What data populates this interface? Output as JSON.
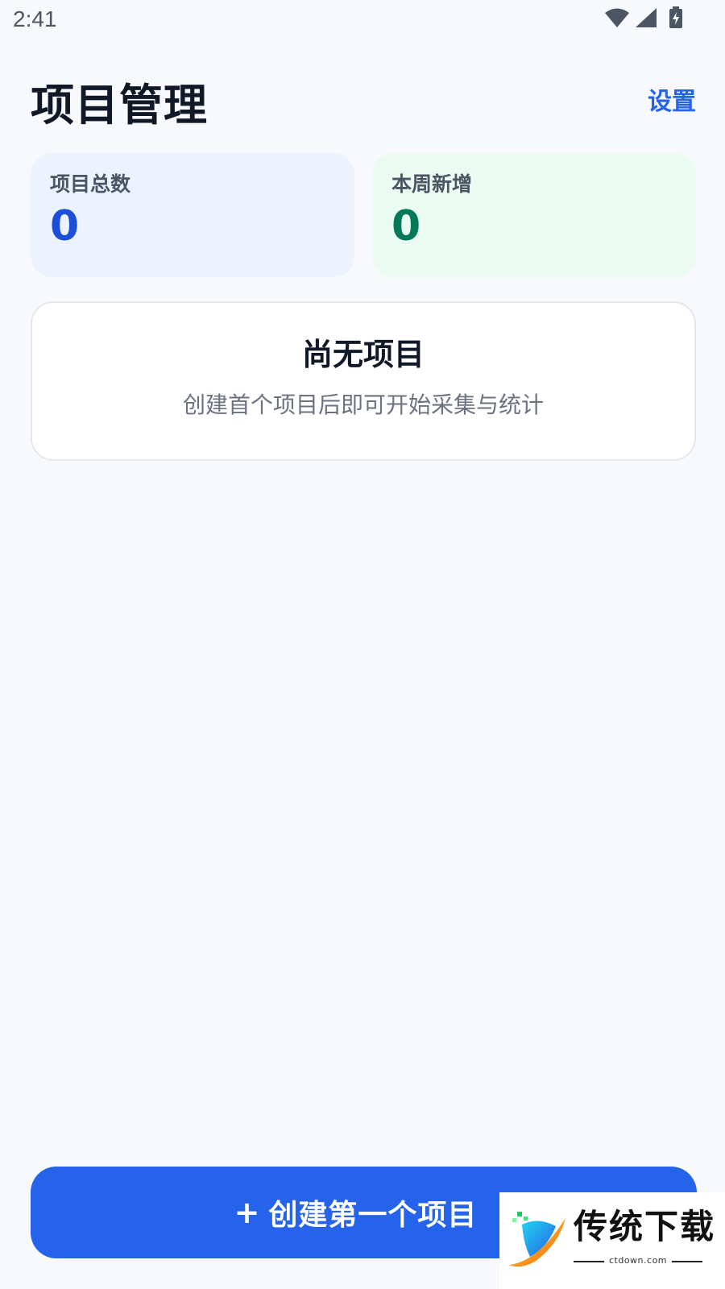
{
  "status_bar": {
    "time": "2:41",
    "icons": [
      "wifi-icon",
      "cellular-signal-icon",
      "battery-charging-icon"
    ]
  },
  "header": {
    "title": "项目管理",
    "settings_label": "设置"
  },
  "stats": {
    "total": {
      "label": "项目总数",
      "value": "0"
    },
    "this_week": {
      "label": "本周新增",
      "value": "0"
    }
  },
  "empty_state": {
    "title": "尚无项目",
    "subtitle": "创建首个项目后即可开始采集与统计"
  },
  "primary_action": {
    "icon": "+",
    "label": "创建第一个项目"
  },
  "watermark": {
    "text": "传统下载",
    "site": "ctdown.com"
  },
  "colors": {
    "accent": "#2563EB",
    "total_value": "#1D4ED8",
    "week_value": "#047857",
    "total_card_bg": "#ECF3FF",
    "week_card_bg": "#EAFBF1",
    "page_bg": "#F7F9FC"
  }
}
